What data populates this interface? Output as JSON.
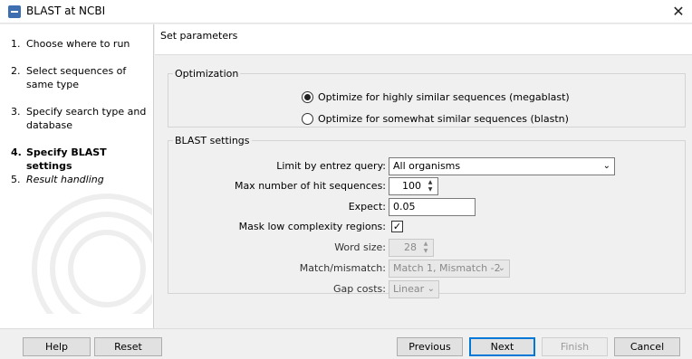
{
  "window": {
    "title": "BLAST at NCBI",
    "close_glyph": "✕"
  },
  "steps": [
    {
      "num": "1.",
      "label": "Choose where to run"
    },
    {
      "num": "2.",
      "label": "Select sequences of same type"
    },
    {
      "num": "3.",
      "label": "Specify search type and database"
    },
    {
      "num": "4.",
      "label": "Specify BLAST settings"
    },
    {
      "num": "5.",
      "label": "Result handling"
    }
  ],
  "section": {
    "title": "Set parameters"
  },
  "optimization": {
    "legend": "Optimization",
    "options": [
      {
        "label": "Optimize for highly similar sequences (megablast)",
        "selected": true
      },
      {
        "label": "Optimize for somewhat similar sequences (blastn)",
        "selected": false
      }
    ]
  },
  "blast_settings": {
    "legend": "BLAST settings",
    "entrez_label": "Limit by entrez query:",
    "entrez_value": "All organisms",
    "max_hits_label": "Max number of hit sequences:",
    "max_hits_value": "100",
    "expect_label": "Expect:",
    "expect_value": "0.05",
    "mask_label": "Mask low complexity regions:",
    "mask_checked": true,
    "word_size_label": "Word size:",
    "word_size_value": "28",
    "match_label": "Match/mismatch:",
    "match_value": "Match 1, Mismatch -2",
    "gap_label": "Gap costs:",
    "gap_value": "Linear"
  },
  "buttons": {
    "help": "Help",
    "reset": "Reset",
    "previous": "Previous",
    "next": "Next",
    "finish": "Finish",
    "cancel": "Cancel"
  },
  "icons": {
    "dropdown": "chevron-down-icon",
    "spin_up": "▲",
    "spin_down": "▼",
    "check": "✓"
  },
  "colors": {
    "default_button_border": "#0078d7",
    "app_icon": "#3d6fb0"
  }
}
